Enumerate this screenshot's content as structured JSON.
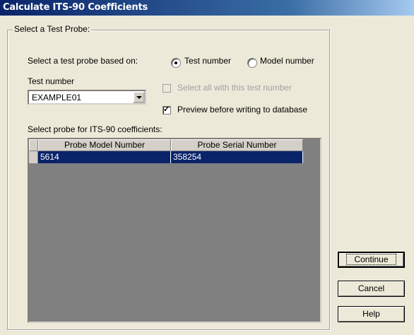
{
  "window": {
    "title": "Calculate ITS-90 Coefficients"
  },
  "group": {
    "legend": "Select a Test Probe:"
  },
  "selection": {
    "label": "Select a test probe based on:",
    "options": [
      {
        "label": "Test number",
        "selected": true
      },
      {
        "label": "Model number",
        "selected": false
      }
    ]
  },
  "test_number": {
    "label": "Test number",
    "value": "EXAMPLE01"
  },
  "checkboxes": [
    {
      "label": "Select all with this test number",
      "checked": false,
      "enabled": false
    },
    {
      "label": "Preview before writing to database",
      "checked": true,
      "enabled": true
    }
  ],
  "probe_list": {
    "label": "Select probe for ITS-90 coefficients:",
    "columns": [
      "Probe Model Number",
      "Probe Serial Number"
    ],
    "rows": [
      {
        "model": "5614",
        "serial": "358254"
      }
    ]
  },
  "buttons": {
    "continue": "Continue",
    "cancel": "Cancel",
    "help": "Help"
  },
  "colors": {
    "titlebar": "#0a246a",
    "selection": "#0a246a",
    "face": "#ece9d8"
  }
}
